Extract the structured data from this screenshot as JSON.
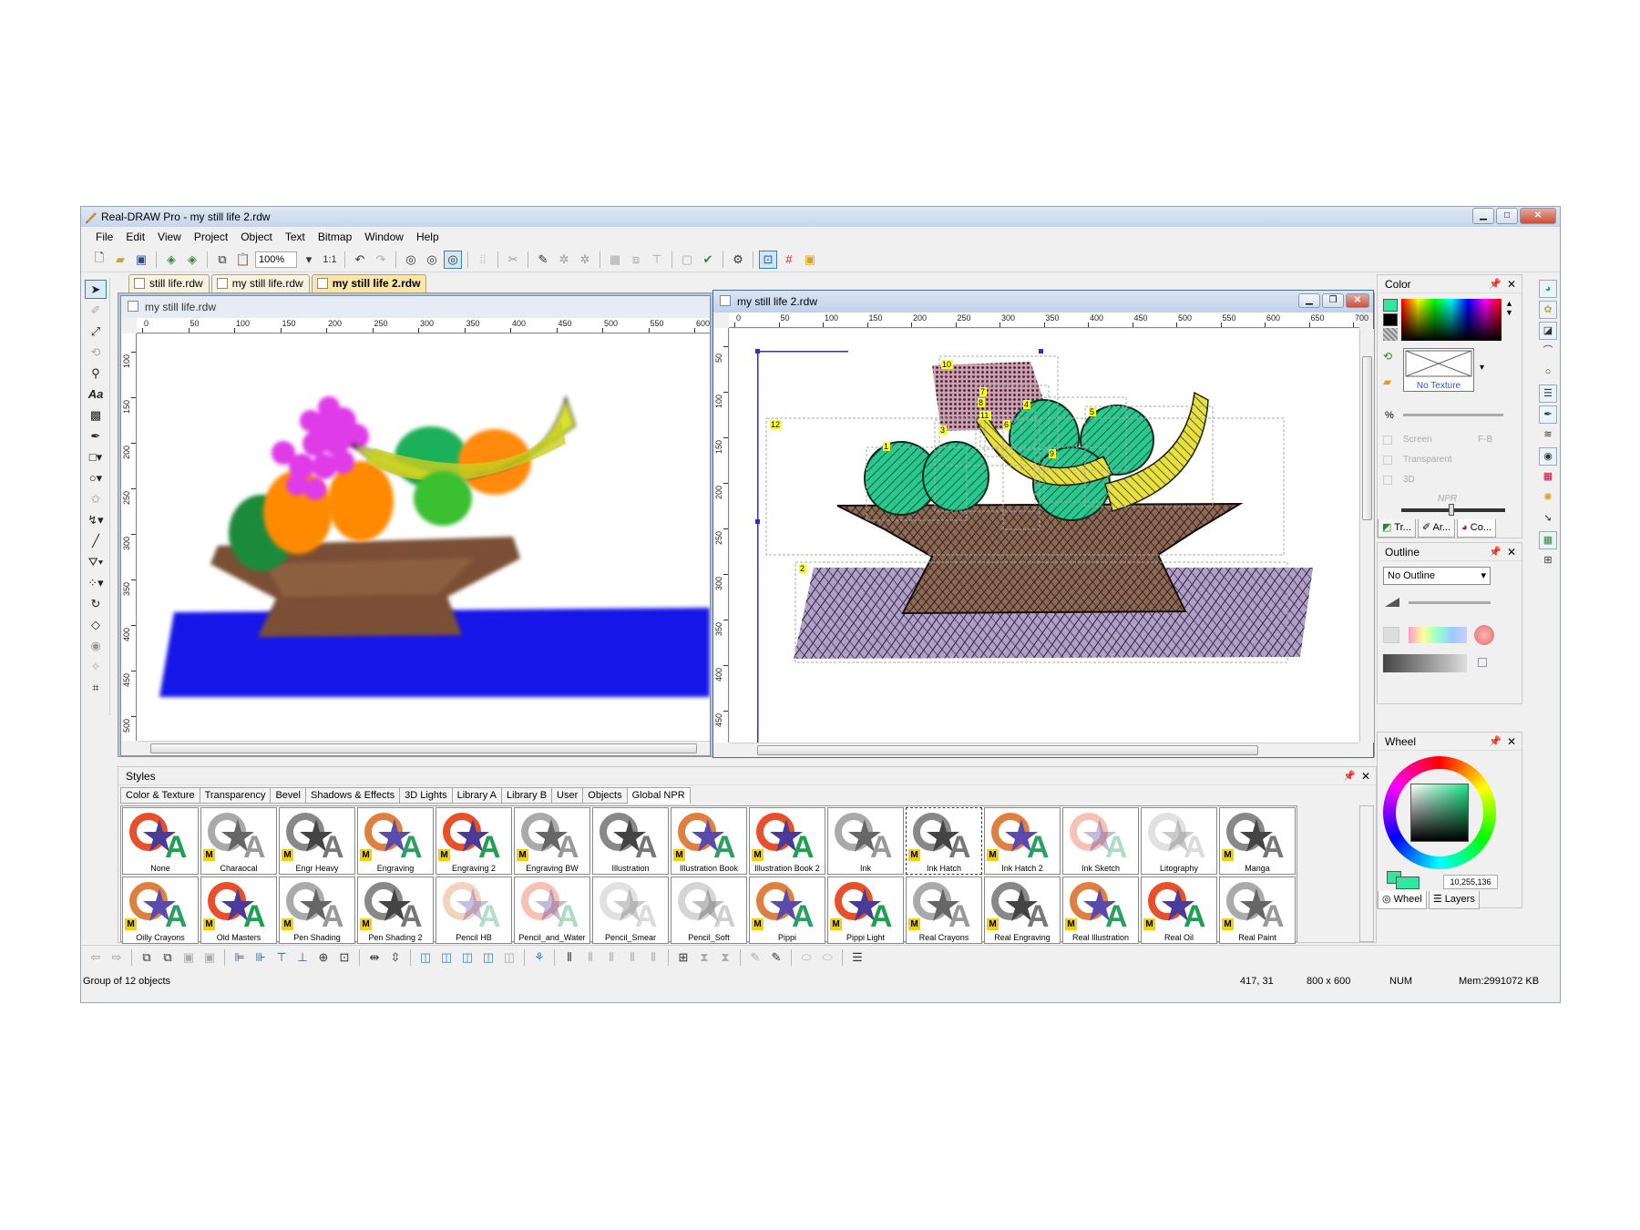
{
  "window": {
    "title": "Real-DRAW Pro - my still life 2.rdw",
    "min_icon": "minimize-icon",
    "max_icon": "maximize-icon",
    "close_label": "✕"
  },
  "menu": [
    "File",
    "Edit",
    "View",
    "Project",
    "Object",
    "Text",
    "Bitmap",
    "Window",
    "Help"
  ],
  "toolbar": {
    "zoom": "100%",
    "ratio": "1:1"
  },
  "doc_tabs": [
    {
      "label": "still life.rdw",
      "active": false
    },
    {
      "label": "my still life.rdw",
      "active": false
    },
    {
      "label": "my still life 2.rdw",
      "active": true
    }
  ],
  "doc_left": {
    "title": "my still life.rdw",
    "hruler": [
      "0",
      "50",
      "100",
      "150",
      "200",
      "250",
      "300",
      "350",
      "400",
      "450",
      "500",
      "550",
      "600"
    ],
    "vruler": [
      "100",
      "150",
      "200",
      "250",
      "300",
      "350",
      "400",
      "450",
      "500"
    ]
  },
  "doc_right": {
    "title": "my still life 2.rdw",
    "hruler": [
      "0",
      "50",
      "100",
      "150",
      "200",
      "250",
      "300",
      "350",
      "400",
      "450",
      "500",
      "550",
      "600",
      "650",
      "700"
    ],
    "vruler": [
      "50",
      "100",
      "150",
      "200",
      "250",
      "300",
      "350",
      "400",
      "450"
    ],
    "labels": [
      "1",
      "2",
      "3",
      "4",
      "5",
      "6",
      "7",
      "8",
      "9",
      "10",
      "11",
      "12"
    ]
  },
  "styles": {
    "title": "Styles",
    "tabs": [
      "Color & Texture",
      "Transparency",
      "Bevel",
      "Shadows & Effects",
      "3D Lights",
      "Library A",
      "Library B",
      "User",
      "Objects",
      "Global NPR"
    ],
    "active_tab": "Global NPR",
    "items": [
      {
        "label": "None",
        "m": false
      },
      {
        "label": "Charaocal",
        "m": true
      },
      {
        "label": "Engr Heavy",
        "m": true
      },
      {
        "label": "Engraving",
        "m": true
      },
      {
        "label": "Engraving 2",
        "m": true
      },
      {
        "label": "Engraving BW",
        "m": true
      },
      {
        "label": "Illustration",
        "m": false
      },
      {
        "label": "Illustration Book",
        "m": true
      },
      {
        "label": "Illustration Book 2",
        "m": true
      },
      {
        "label": "Ink",
        "m": false
      },
      {
        "label": "Ink Hatch",
        "m": true
      },
      {
        "label": "Ink Hatch 2",
        "m": true
      },
      {
        "label": "Ink Sketch",
        "m": false
      },
      {
        "label": "Litography",
        "m": false
      },
      {
        "label": "Manga",
        "m": true
      },
      {
        "label": "Oilly Crayons",
        "m": true
      },
      {
        "label": "Old Masters",
        "m": true
      },
      {
        "label": "Pen Shading",
        "m": true
      },
      {
        "label": "Pen Shading 2",
        "m": true
      },
      {
        "label": "Pencil HB",
        "m": false
      },
      {
        "label": "Pencil_and_Water",
        "m": false
      },
      {
        "label": "Pencil_Smear",
        "m": false
      },
      {
        "label": "Pencil_Soft",
        "m": false
      },
      {
        "label": "Pippi",
        "m": true
      },
      {
        "label": "Pippi Light",
        "m": true
      },
      {
        "label": "Real Crayons",
        "m": true
      },
      {
        "label": "Real Engraving",
        "m": true
      },
      {
        "label": "Real Illustration",
        "m": true
      },
      {
        "label": "Real Oil",
        "m": true
      },
      {
        "label": "Real Paint",
        "m": true
      }
    ],
    "badge": "M"
  },
  "color_panel": {
    "title": "Color",
    "texture": "No Texture",
    "pct": "%",
    "screen": "Screen",
    "fb": "F-B",
    "transparent": "Transparent",
    "three_d": "3D",
    "npr": "NPR",
    "tabs": [
      "Tr...",
      "Ar...",
      "Co..."
    ],
    "accent": "#2ee8a0"
  },
  "outline_panel": {
    "title": "Outline",
    "value": "No Outline"
  },
  "wheel_panel": {
    "title": "Wheel",
    "rgb": "10,255,136",
    "tabs": [
      "Wheel",
      "Layers"
    ]
  },
  "status": {
    "message": "Group of 12 objects",
    "coords": "417, 31",
    "size": "800 x 600",
    "num": "NUM",
    "mem": "Mem:2991072 KB"
  }
}
